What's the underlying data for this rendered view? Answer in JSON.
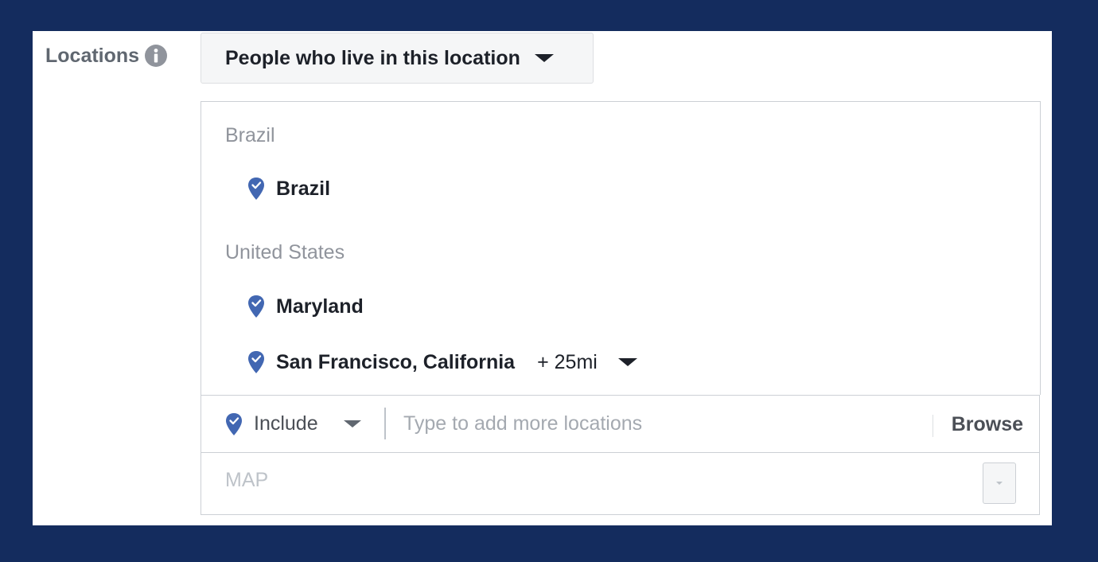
{
  "locations": {
    "label": "Locations",
    "info_icon": "info-icon",
    "audience_type": {
      "selected": "People who live in this location"
    },
    "groups": [
      {
        "title": "Brazil",
        "items": [
          {
            "name": "Brazil",
            "icon": "map-pin-icon"
          }
        ]
      },
      {
        "title": "United States",
        "items": [
          {
            "name": "Maryland",
            "icon": "map-pin-icon"
          },
          {
            "name": "San Francisco, California",
            "icon": "map-pin-icon",
            "radius": "+ 25mi"
          }
        ]
      }
    ],
    "add": {
      "mode": "Include",
      "placeholder": "Type to add more locations",
      "value": "",
      "browse_label": "Browse"
    },
    "map": {
      "label": "MAP"
    }
  },
  "colors": {
    "background": "#142c5e",
    "pin": "#4267b2",
    "text_primary": "#1d2129",
    "text_muted": "#90949c"
  }
}
